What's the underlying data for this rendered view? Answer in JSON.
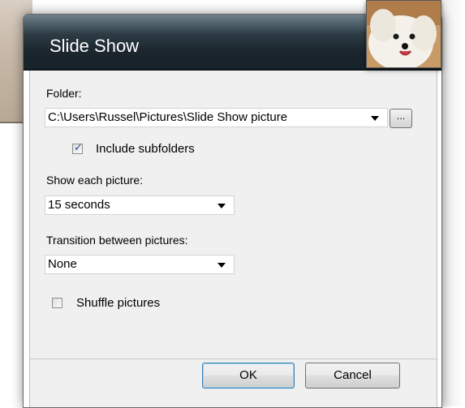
{
  "window": {
    "title": "Slide Show"
  },
  "folder": {
    "label": "Folder:",
    "value": "C:\\Users\\Russel\\Pictures\\Slide Show picture",
    "browse_label": "..."
  },
  "include_subfolders": {
    "label": "Include subfolders",
    "checked": true
  },
  "show_each": {
    "label": "Show each picture:",
    "value": "15 seconds"
  },
  "transition": {
    "label": "Transition between pictures:",
    "value": "None"
  },
  "shuffle": {
    "label": "Shuffle pictures",
    "checked": false
  },
  "buttons": {
    "ok": "OK",
    "cancel": "Cancel"
  },
  "colors": {
    "titlebar": "#1a252c",
    "dialog_bg": "#f0f0f0",
    "check_mark": "#2b4a8c"
  }
}
